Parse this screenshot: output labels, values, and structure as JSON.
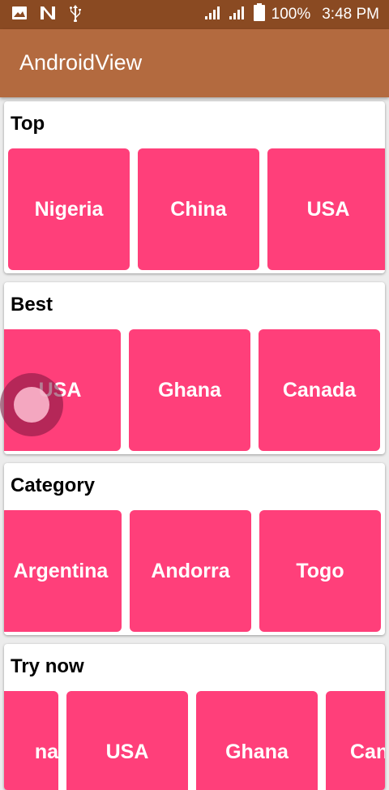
{
  "status_bar": {
    "battery_percent": "100%",
    "time": "3:48 PM",
    "icons": [
      "image-icon",
      "n-icon",
      "usb-icon",
      "signal-icon",
      "signal-icon-2",
      "battery-icon"
    ]
  },
  "app_bar": {
    "title": "AndroidView"
  },
  "sections": [
    {
      "title": "Top",
      "items": [
        "Nigeria",
        "China",
        "USA"
      ]
    },
    {
      "title": "Best",
      "items": [
        "USA",
        "Ghana",
        "Canada"
      ]
    },
    {
      "title": "Category",
      "items": [
        "Argentina",
        "Andorra",
        "Togo"
      ]
    },
    {
      "title": "Try now",
      "items": [
        "na",
        "USA",
        "Ghana",
        "Can"
      ]
    }
  ],
  "colors": {
    "status_bar": "#8a4a22",
    "app_bar": "#b36a3f",
    "tile": "#ff3f7a",
    "background": "#ececec"
  }
}
